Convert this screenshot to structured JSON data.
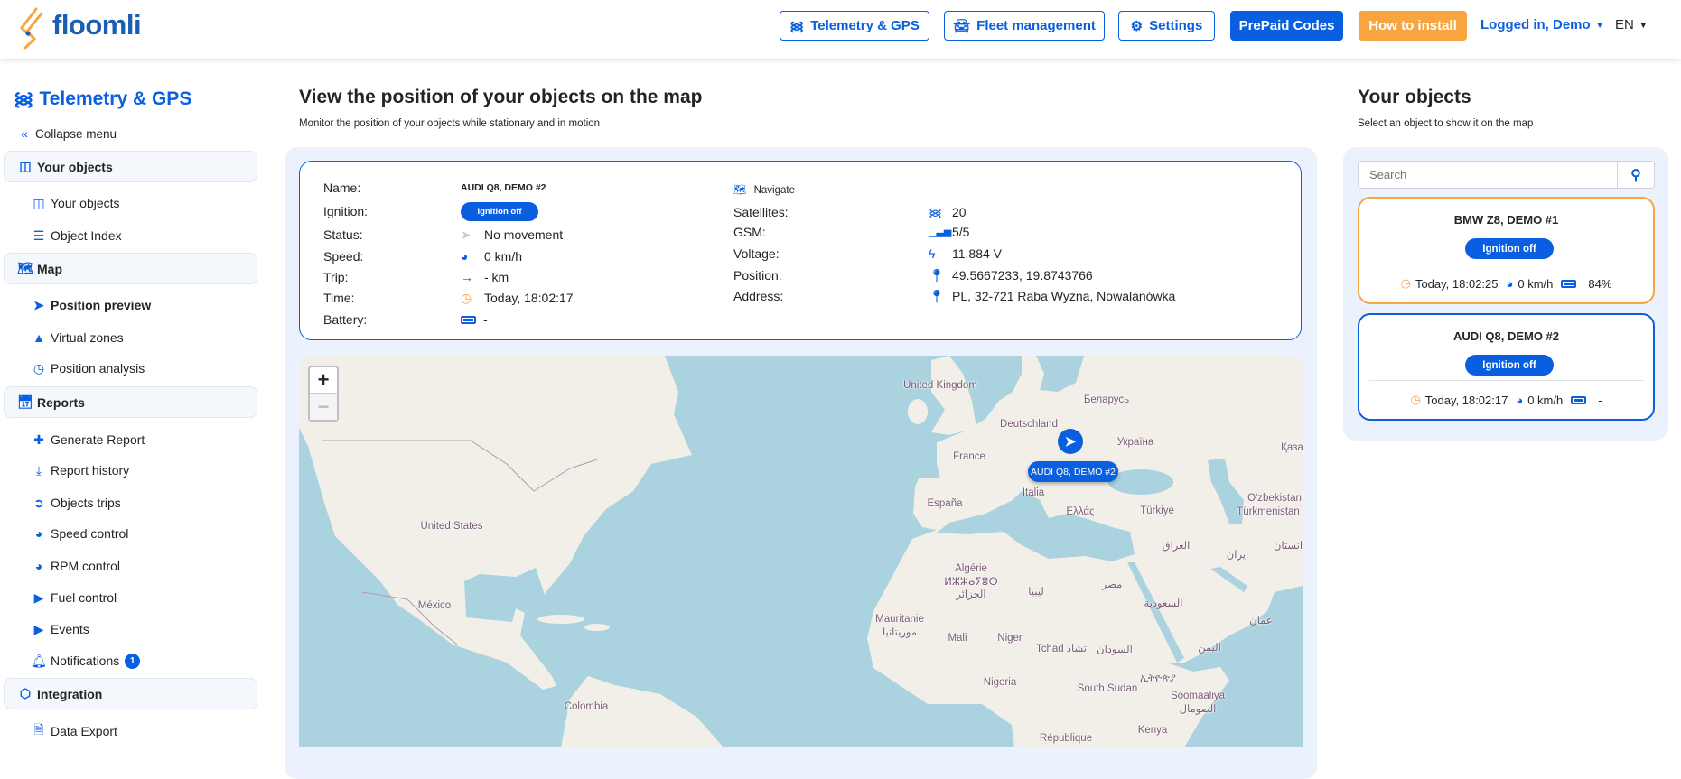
{
  "header": {
    "logo": "floomli",
    "nav": [
      {
        "label": "Telemetry & GPS",
        "icon": "wifi-icon"
      },
      {
        "label": "Fleet management",
        "icon": "car-icon"
      },
      {
        "label": "Settings",
        "icon": "gears-icon"
      },
      {
        "label": "PrePaid Codes"
      },
      {
        "label": "How to install"
      }
    ],
    "user": "Logged in, Demo",
    "lang": "EN"
  },
  "sidebar": {
    "title": "Telemetry & GPS",
    "collapse": "Collapse menu",
    "sections": {
      "objects": "Your objects",
      "map": "Map",
      "reports": "Reports",
      "integration": "Integration"
    },
    "items": {
      "your_objects": "Your objects",
      "object_index": "Object Index",
      "position_preview": "Position preview",
      "virtual_zones": "Virtual zones",
      "position_analysis": "Position analysis",
      "generate_report": "Generate Report",
      "report_history": "Report history",
      "objects_trips": "Objects trips",
      "speed_control": "Speed control",
      "rpm_control": "RPM control",
      "fuel_control": "Fuel control",
      "events": "Events",
      "notifications": "Notifications",
      "notifications_count": "1",
      "data_export": "Data Export"
    }
  },
  "main": {
    "title": "View the position of your objects on the map",
    "subtitle": "Monitor the position of your objects while stationary and in motion",
    "info": {
      "name_label": "Name:",
      "name": "AUDI Q8, DEMO #2",
      "ignition_label": "Ignition:",
      "ignition": "Ignition off",
      "status_label": "Status:",
      "status": "No movement",
      "speed_label": "Speed:",
      "speed": "0 km/h",
      "trip_label": "Trip:",
      "trip": "- km",
      "time_label": "Time:",
      "time": "Today, 18:02:17",
      "battery_label": "Battery:",
      "battery": "-",
      "navigate": "Navigate",
      "satellites_label": "Satellites:",
      "satellites": "20",
      "gsm_label": "GSM:",
      "gsm": "5/5",
      "voltage_label": "Voltage:",
      "voltage": "11.884 V",
      "position_label": "Position:",
      "position": "49.5667233, 19.8743766",
      "address_label": "Address:",
      "address": "PL, 32-721 Raba Wyżna, Nowalanówka"
    },
    "map": {
      "zoom_in": "+",
      "zoom_out": "−",
      "marker_label": "AUDI Q8, DEMO #2",
      "labels": [
        "United Kingdom",
        "Беларусь",
        "Deutschland",
        "Україна",
        "France",
        "Italia",
        "España",
        "Ελλάς",
        "Türkiye",
        "O'zbekistan",
        "Türkmenistan",
        "Қазақ",
        "United States",
        "México",
        "Colombia",
        "Algérie",
        "ⵍⵣⵣⴰⵢⴻⵔ",
        "الجزائر",
        "ليبيا",
        "مصر",
        "العراق",
        "ايران",
        "السعودية",
        "عمان",
        "Mauritanie",
        "موريتانيا",
        "Mali",
        "Niger",
        "Tchad تشاد",
        "السودان",
        "اليمن",
        "Nigeria",
        "South Sudan",
        "ኢትዮጵያ",
        "Soomaaliya",
        "الصومال",
        "Kenya",
        "République",
        "انستان"
      ]
    }
  },
  "objects": {
    "title": "Your objects",
    "subtitle": "Select an object to show it on the map",
    "search_placeholder": "Search",
    "list": [
      {
        "name": "BMW Z8, DEMO #1",
        "ignition": "Ignition off",
        "time": "Today, 18:02:25",
        "speed": "0 km/h",
        "battery": "84%"
      },
      {
        "name": "AUDI Q8, DEMO #2",
        "ignition": "Ignition off",
        "time": "Today, 18:02:17",
        "speed": "0 km/h",
        "battery": "-"
      }
    ]
  },
  "colors": {
    "primary": "#0a5fe0",
    "accent": "#f7a540",
    "water": "#aad3df",
    "land": "#f2efe9"
  }
}
